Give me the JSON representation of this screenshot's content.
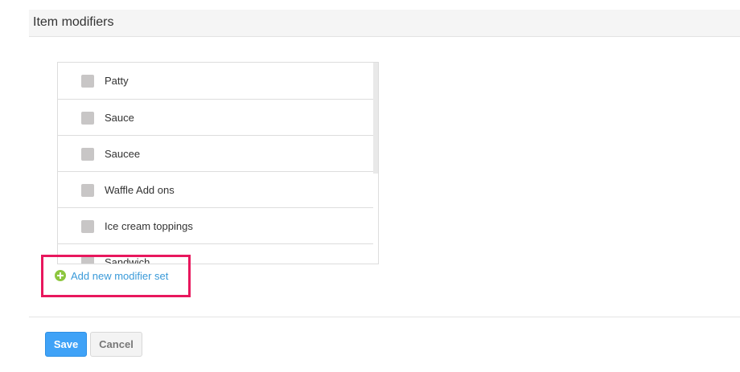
{
  "section": {
    "title": "Item modifiers"
  },
  "modifier_list": {
    "items": [
      {
        "label": "Patty",
        "checked": false
      },
      {
        "label": "Sauce",
        "checked": false
      },
      {
        "label": "Saucee",
        "checked": false
      },
      {
        "label": "Waffle Add ons",
        "checked": false
      },
      {
        "label": "Ice cream toppings",
        "checked": false
      },
      {
        "label": "Sandwich",
        "checked": false
      }
    ]
  },
  "add_modifier": {
    "label": "Add new modifier set",
    "icon": "plus-circle-icon",
    "color": "#3a9ad9",
    "icon_color": "#8dc63f"
  },
  "highlight": {
    "color": "#e8175d"
  },
  "actions": {
    "save_label": "Save",
    "cancel_label": "Cancel",
    "save_color": "#3fa2f7"
  }
}
